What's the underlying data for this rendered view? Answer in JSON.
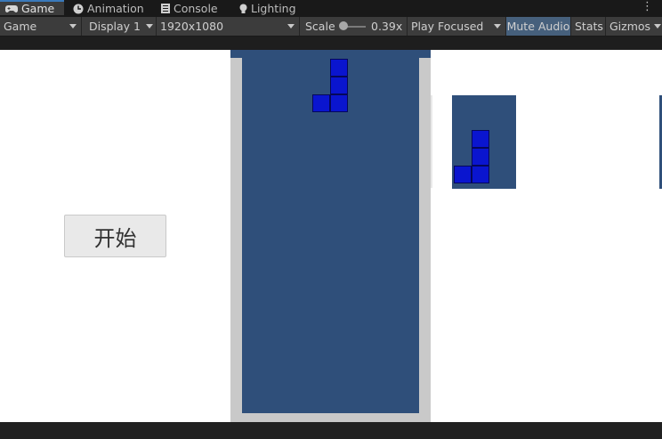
{
  "tabs": [
    {
      "label": "Game",
      "icon": "gamepad-icon",
      "active": true
    },
    {
      "label": "Animation",
      "icon": "clock-icon",
      "active": false
    },
    {
      "label": "Console",
      "icon": "console-icon",
      "active": false
    },
    {
      "label": "Lighting",
      "icon": "lightbulb-icon",
      "active": false
    }
  ],
  "toolbar": {
    "view_label": "Game",
    "display_label": "Display 1",
    "resolution_label": "1920x1080",
    "scale_label": "Scale",
    "scale_value": "0.39x",
    "scale_fraction": 0.05,
    "play_mode_label": "Play Focused",
    "mute_audio_label": "Mute Audio",
    "mute_audio_on": true,
    "stats_label": "Stats",
    "gizmos_label": "Gizmos"
  },
  "game": {
    "start_button_label": "开始",
    "colors": {
      "board": "#2f4f7a",
      "frame": "#c9c9c9",
      "block": "#0a15cf",
      "block_border": "#05085a"
    },
    "active_piece": {
      "shape": "J",
      "cells": [
        [
          1,
          0
        ],
        [
          1,
          1
        ],
        [
          0,
          2
        ],
        [
          1,
          2
        ]
      ]
    },
    "next_piece": {
      "shape": "J",
      "cells": [
        [
          1,
          0
        ],
        [
          1,
          1
        ],
        [
          0,
          2
        ],
        [
          1,
          2
        ]
      ]
    }
  }
}
